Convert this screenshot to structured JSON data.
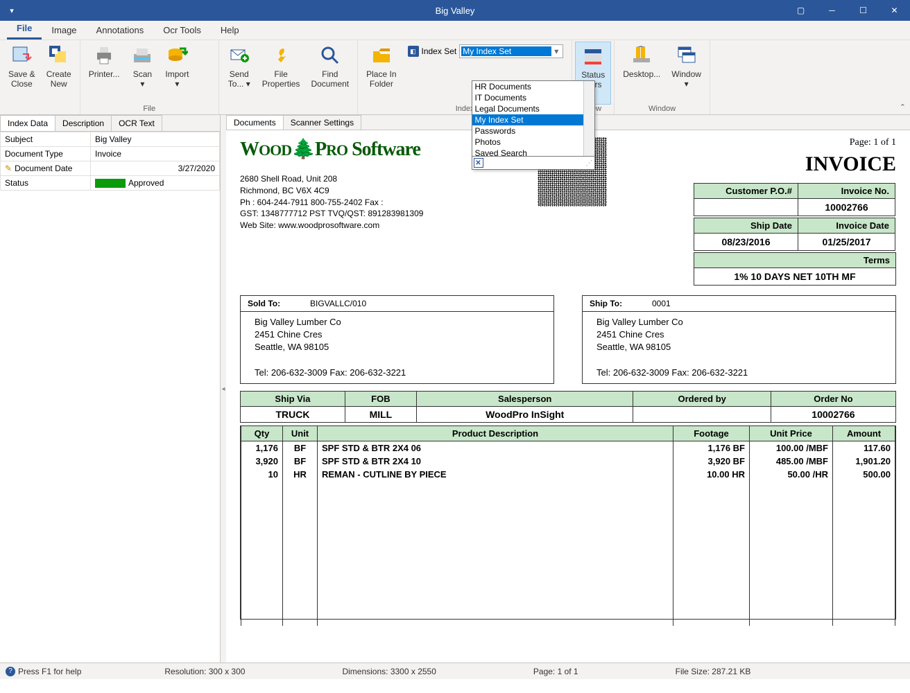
{
  "app_title": "Big Valley",
  "menu_tabs": [
    "File",
    "Image",
    "Annotations",
    "Ocr Tools",
    "Help"
  ],
  "ribbon": {
    "groups": {
      "file": "File",
      "index": "Index",
      "view": "View",
      "window": "Window"
    },
    "buttons": {
      "save_close": "Save &\nClose",
      "create_new": "Create\nNew",
      "printer": "Printer...",
      "scan": "Scan\n▾",
      "import": "Import\n▾",
      "send_to": "Send\nTo... ▾",
      "file_properties": "File\nProperties",
      "find_document": "Find\nDocument",
      "place_in_folder": "Place In\nFolder",
      "index_set_label": "Index Set",
      "status_bars": "Status\nBars",
      "desktop": "Desktop...",
      "window": "Window\n▾"
    },
    "index_set_selected": "My Index Set",
    "index_set_options": [
      "HR Documents",
      "IT Documents",
      "Legal Documents",
      "My Index Set",
      "Passwords",
      "Photos",
      "Saved Search"
    ]
  },
  "left_tabs": [
    "Index Data",
    "Description",
    "OCR Text"
  ],
  "index_fields": {
    "subject": {
      "label": "Subject",
      "value": "Big Valley"
    },
    "doc_type": {
      "label": "Document Type",
      "value": "Invoice"
    },
    "doc_date": {
      "label": "Document Date",
      "value": "3/27/2020"
    },
    "status": {
      "label": "Status",
      "value": "Approved"
    }
  },
  "doc_tabs": [
    "Documents",
    "Scanner Settings"
  ],
  "invoice": {
    "page_label": "Page: 1 of 1",
    "title": "INVOICE",
    "company": "WoodPro Software",
    "address": {
      "line1": "2680 Shell Road, Unit 208",
      "line2": "Richmond, BC  V6X 4C9",
      "line3": "Ph  : 604-244-7911  800-755-2402  Fax :",
      "line4": "GST: 1348777712  PST TVQ/QST: 891283981309",
      "line5": "Web Site: www.woodprosoftware.com"
    },
    "hdr": {
      "cust_po_label": "Customer P.O.#",
      "cust_po": "",
      "inv_no_label": "Invoice No.",
      "inv_no": "10002766",
      "ship_date_label": "Ship Date",
      "ship_date": "08/23/2016",
      "inv_date_label": "Invoice Date",
      "inv_date": "01/25/2017",
      "terms_label": "Terms",
      "terms": "1% 10 DAYS NET 10TH MF"
    },
    "sold_to": {
      "label": "Sold To:",
      "code": "BIGVALLC/010",
      "name": "Big Valley Lumber Co",
      "addr1": "2451 Chine Cres",
      "addr2": "Seattle,  WA 98105",
      "telfax": "Tel: 206-632-3009  Fax: 206-632-3221"
    },
    "ship_to": {
      "label": "Ship To:",
      "code": "0001",
      "name": "Big Valley Lumber Co",
      "addr1": "2451 Chine Cres",
      "addr2": "Seattle,  WA 98105",
      "telfax": "Tel: 206-632-3009  Fax: 206-632-3221"
    },
    "order_hdr": {
      "ship_via_l": "Ship Via",
      "ship_via": "TRUCK",
      "fob_l": "FOB",
      "fob": "MILL",
      "sales_l": "Salesperson",
      "sales": "WoodPro InSight",
      "ordered_l": "Ordered by",
      "ordered": "",
      "orderno_l": "Order No",
      "orderno": "10002766"
    },
    "line_hdr": {
      "qty": "Qty",
      "unit": "Unit",
      "desc": "Product Description",
      "footage": "Footage",
      "price": "Unit Price",
      "amount": "Amount"
    },
    "lines": [
      {
        "qty": "1,176",
        "unit": "BF",
        "desc": "SPF STD & BTR 2X4 06",
        "footage": "1,176 BF",
        "price": "100.00 /MBF",
        "amount": "117.60"
      },
      {
        "qty": "3,920",
        "unit": "BF",
        "desc": "SPF STD & BTR 2X4 10",
        "footage": "3,920 BF",
        "price": "485.00 /MBF",
        "amount": "1,901.20"
      },
      {
        "qty": "10",
        "unit": "HR",
        "desc": "REMAN - CUTLINE BY PIECE",
        "footage": "10.00 HR",
        "price": "50.00 /HR",
        "amount": "500.00"
      }
    ]
  },
  "statusbar": {
    "help": "Press F1 for help",
    "resolution": "Resolution: 300 x 300",
    "dimensions": "Dimensions: 3300 x 2550",
    "page": "Page: 1 of 1",
    "filesize": "File Size: 287.21 KB"
  }
}
